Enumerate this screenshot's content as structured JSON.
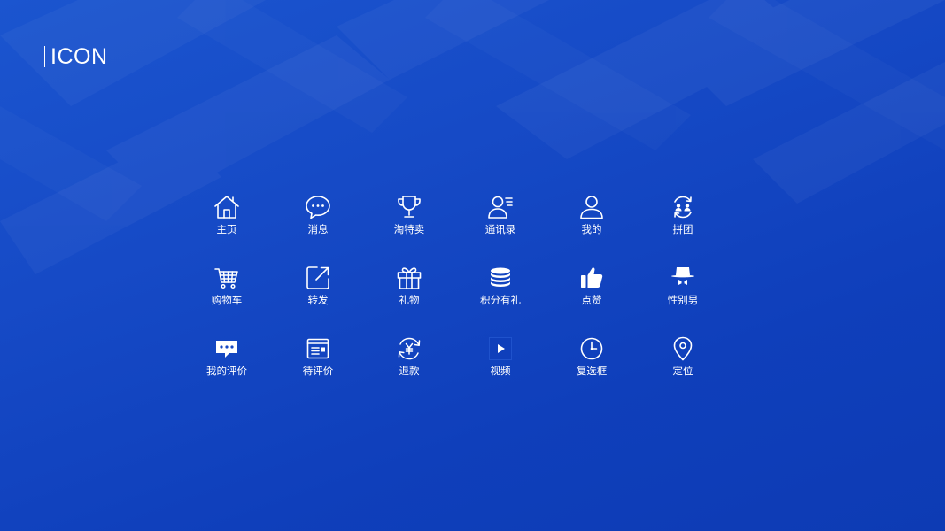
{
  "page": {
    "title": "ICON"
  },
  "colors": {
    "background": "#1548c4",
    "foreground": "#ffffff"
  },
  "icons": [
    {
      "label": "主页",
      "icon": "home-icon"
    },
    {
      "label": "消息",
      "icon": "message-bubble-icon"
    },
    {
      "label": "淘特卖",
      "icon": "trophy-icon"
    },
    {
      "label": "通讯录",
      "icon": "contacts-icon"
    },
    {
      "label": "我的",
      "icon": "user-icon"
    },
    {
      "label": "拼团",
      "icon": "group-buy-icon"
    },
    {
      "label": "购物车",
      "icon": "shopping-cart-icon"
    },
    {
      "label": "转发",
      "icon": "share-forward-icon"
    },
    {
      "label": "礼物",
      "icon": "gift-icon"
    },
    {
      "label": "积分有礼",
      "icon": "coin-stack-icon"
    },
    {
      "label": "点赞",
      "icon": "thumbs-up-icon"
    },
    {
      "label": "性别男",
      "icon": "gentleman-icon"
    },
    {
      "label": "我的评价",
      "icon": "comment-icon"
    },
    {
      "label": "待评价",
      "icon": "pending-review-icon"
    },
    {
      "label": "退款",
      "icon": "refund-icon"
    },
    {
      "label": "视频",
      "icon": "video-play-icon"
    },
    {
      "label": "复选框",
      "icon": "clock-icon"
    },
    {
      "label": "定位",
      "icon": "location-pin-icon"
    }
  ]
}
